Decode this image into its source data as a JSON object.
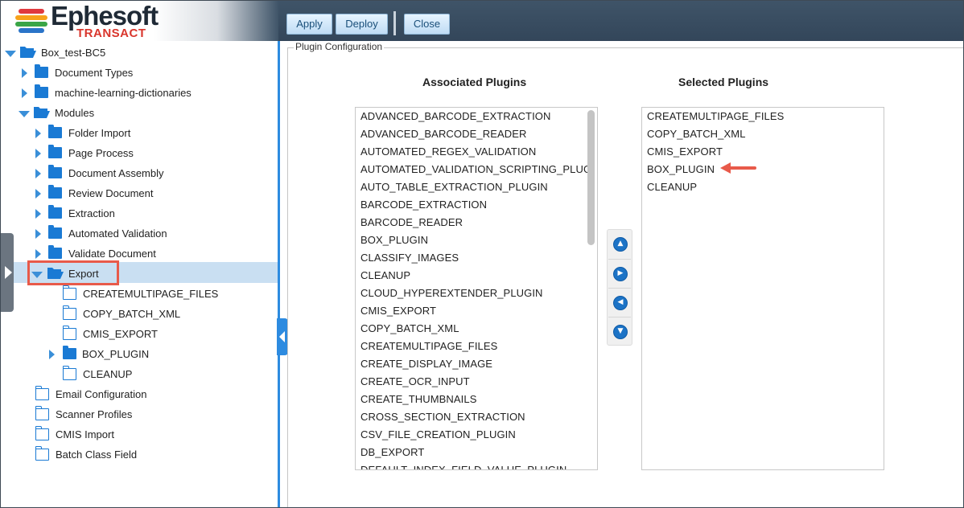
{
  "app": {
    "logo_word": "Ephesoft",
    "logo_sub": "TRANSACT",
    "accent": "#2d8be0",
    "highlight": "#e85a4a"
  },
  "toolbar": {
    "apply_label": "Apply",
    "deploy_label": "Deploy",
    "close_label": "Close"
  },
  "tree": {
    "root": "Box_test-BC5",
    "document_types": "Document Types",
    "ml_dictionaries": "machine-learning-dictionaries",
    "modules": "Modules",
    "module_items": [
      "Folder Import",
      "Page Process",
      "Document Assembly",
      "Review Document",
      "Extraction",
      "Automated Validation",
      "Validate Document",
      "Export"
    ],
    "export_children": [
      "CREATEMULTIPAGE_FILES",
      "COPY_BATCH_XML",
      "CMIS_EXPORT",
      "BOX_PLUGIN",
      "CLEANUP"
    ],
    "bottom_items": [
      "Email Configuration",
      "Scanner Profiles",
      "CMIS Import",
      "Batch Class Field"
    ]
  },
  "plugin_config": {
    "legend": "Plugin Configuration",
    "associated_title": "Associated Plugins",
    "selected_title": "Selected Plugins",
    "associated": [
      "ADVANCED_BARCODE_EXTRACTION",
      "ADVANCED_BARCODE_READER",
      "AUTOMATED_REGEX_VALIDATION",
      "AUTOMATED_VALIDATION_SCRIPTING_PLUG",
      "AUTO_TABLE_EXTRACTION_PLUGIN",
      "BARCODE_EXTRACTION",
      "BARCODE_READER",
      "BOX_PLUGIN",
      "CLASSIFY_IMAGES",
      "CLEANUP",
      "CLOUD_HYPEREXTENDER_PLUGIN",
      "CMIS_EXPORT",
      "COPY_BATCH_XML",
      "CREATEMULTIPAGE_FILES",
      "CREATE_DISPLAY_IMAGE",
      "CREATE_OCR_INPUT",
      "CREATE_THUMBNAILS",
      "CROSS_SECTION_EXTRACTION",
      "CSV_FILE_CREATION_PLUGIN",
      "DB_EXPORT",
      "DEFAULT_INDEX_FIELD_VALUE_PLUGIN"
    ],
    "selected": [
      "CREATEMULTIPAGE_FILES",
      "COPY_BATCH_XML",
      "CMIS_EXPORT",
      "BOX_PLUGIN",
      "CLEANUP"
    ],
    "move_buttons": {
      "up": "chevron-up-icon",
      "right": "chevron-right-icon",
      "left": "chevron-left-icon",
      "down": "chevron-down-icon"
    }
  }
}
